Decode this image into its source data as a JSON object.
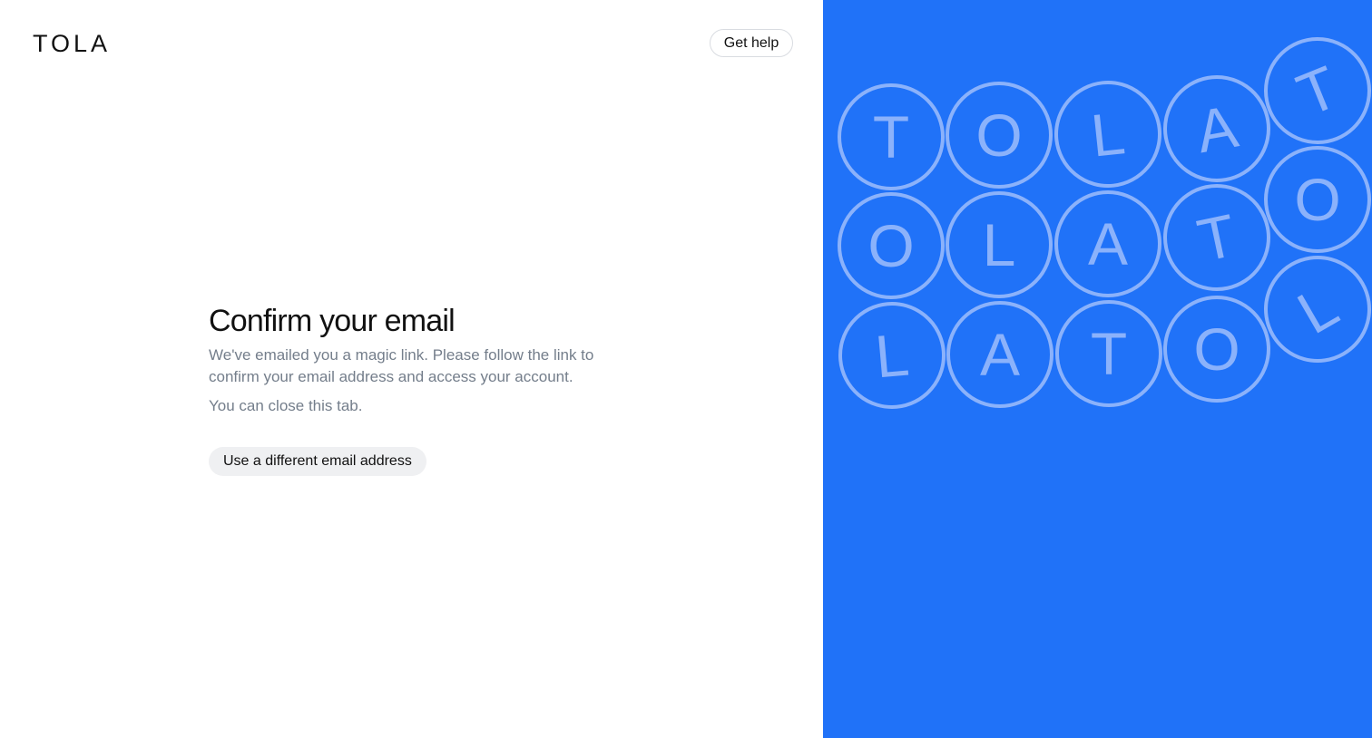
{
  "header": {
    "logo_text": "TOLA",
    "help_label": "Get help"
  },
  "main": {
    "title": "Confirm your email",
    "description": "We've emailed you a magic link. Please follow the link to confirm your email address and access your account.",
    "note": "You can close this tab.",
    "alt_button_label": "Use a different email address"
  },
  "decor": {
    "badges": [
      [
        "T",
        "O",
        "L",
        "A",
        "T"
      ],
      [
        "O",
        "L",
        "A",
        "T",
        "O"
      ],
      [
        "L",
        "A",
        "T",
        "O",
        "L"
      ]
    ]
  },
  "colors": {
    "panel_background": "#2072f8",
    "badge_stroke": "#8bb2fb",
    "text_primary": "#111111",
    "text_secondary": "#747e8b",
    "secondary_button_bg": "#eff0f2"
  }
}
